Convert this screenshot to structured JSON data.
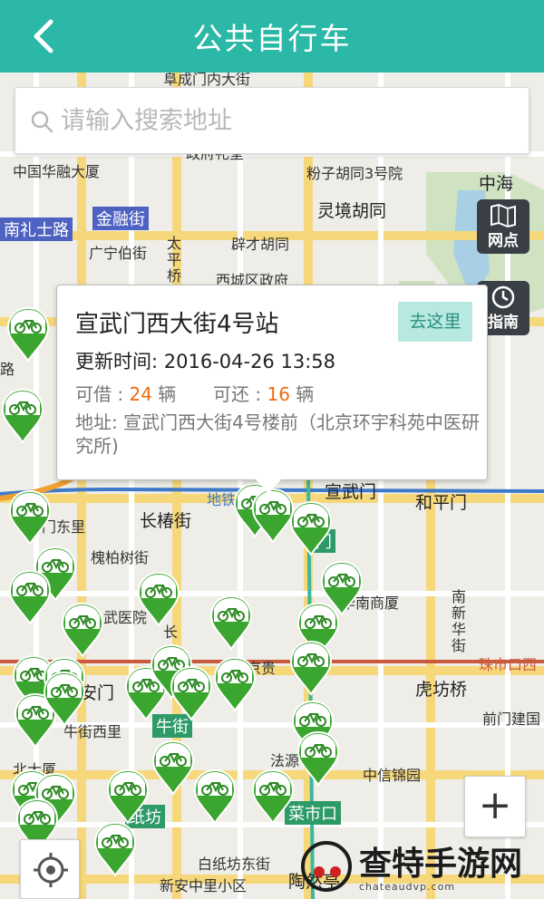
{
  "header": {
    "title": "公共自行车",
    "back_icon": "chevron-left-icon"
  },
  "search": {
    "placeholder": "请输入搜索地址",
    "icon": "search-icon"
  },
  "side_buttons": [
    {
      "label": "网点",
      "icon": "map-icon"
    },
    {
      "label": "指南",
      "icon": "clock-icon"
    }
  ],
  "popup": {
    "station_name": "宣武门西大街4号站",
    "go_label": "去这里",
    "update_text": "更新时间: 2016-04-26 13:58",
    "borrow_label": "可借 :",
    "borrow_count": "24",
    "return_label": "可还 :",
    "return_count": "16",
    "unit": "辆",
    "address": "地址:  宣武门西大街4号楼前（北京环宇科苑中医研究所)"
  },
  "map_labels": {
    "l1": "阜成门内大街",
    "l2": "政府礼堂",
    "l3": "中国华融大厦",
    "l4": "粉子胡同3号院",
    "l5": "中海",
    "l6": "南礼士路",
    "l7": "金融街",
    "l8": "灵境胡同",
    "l9": "广宁伯街",
    "l10": "太平桥",
    "l11": "辟才胡同",
    "l12": "西城区政府",
    "l13": "地铁",
    "l14": "宣武门",
    "l15": "和平门",
    "l16": "长椿街",
    "l17": "门东里",
    "l18": "槐柏树街",
    "l19": "武医院",
    "l20": "南新华街",
    "l21": "中国",
    "l22": "京贵",
    "l23": "珠市口西",
    "l24": "安门",
    "l25": "牛街",
    "l26": "牛街西里",
    "l27": "虎坊桥",
    "l28": "前门建国",
    "l29": "北大厦",
    "l30": "法源",
    "l31": "中信锦园",
    "l32": "纸坊",
    "l33": "菜市口",
    "l34": "白纸坊东街",
    "l35": "新安中里小区",
    "l36": "陶然亭",
    "l37": "前门",
    "l38": "路",
    "l39": "南厦",
    "l40": "门",
    "l41": "长",
    "l42": "华南商厦"
  },
  "watermark": {
    "text": "查特手游网",
    "sub": "chateaudvp.com"
  },
  "controls": {
    "zoom_in": "+",
    "locate_icon": "locate-icon"
  },
  "colors": {
    "header": "#2bb8a6",
    "pin_green": "#3aa52f",
    "count_orange": "#f06a10",
    "go_button": "#b8e9e1"
  }
}
